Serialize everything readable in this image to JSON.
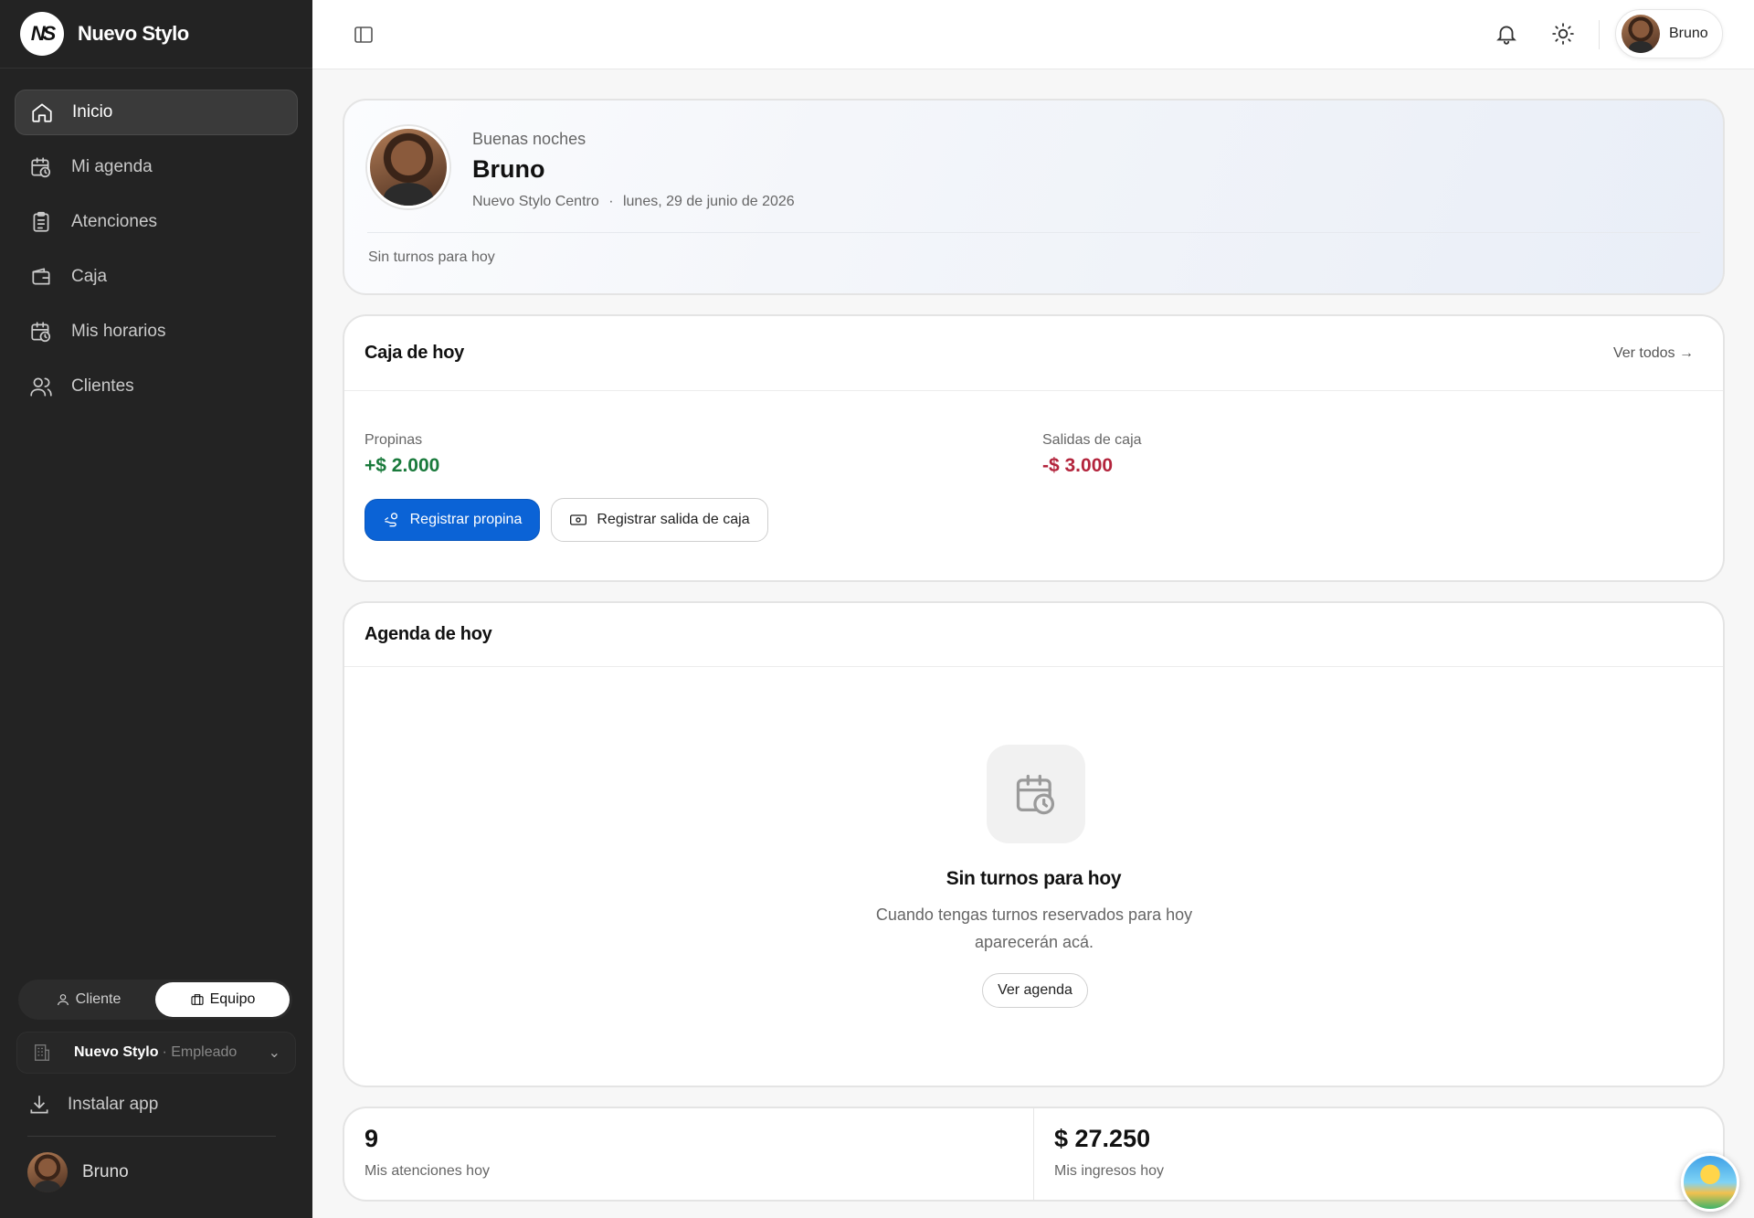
{
  "brand": {
    "name": "Nuevo Stylo",
    "logo_text": "NS"
  },
  "sidebar": {
    "items": [
      {
        "label": "Inicio",
        "icon": "home-icon",
        "active": true
      },
      {
        "label": "Mi agenda",
        "icon": "calendar-clock-icon"
      },
      {
        "label": "Atenciones",
        "icon": "clipboard-icon"
      },
      {
        "label": "Caja",
        "icon": "wallet-icon"
      },
      {
        "label": "Mis horarios",
        "icon": "calendar-clock-icon"
      },
      {
        "label": "Clientes",
        "icon": "users-icon"
      }
    ],
    "toggle": {
      "client_label": "Cliente",
      "team_label": "Equipo",
      "selected": "Equipo"
    },
    "org": {
      "name": "Nuevo Stylo",
      "role": "· Empleado"
    },
    "install_label": "Instalar app",
    "user_name": "Bruno"
  },
  "topbar": {
    "user_name": "Bruno"
  },
  "greeting": {
    "salutation": "Buenas noches",
    "name": "Bruno",
    "location": "Nuevo Stylo Centro",
    "separator": "·",
    "date": "lunes, 29 de junio de 2026",
    "status": "Sin turnos para hoy"
  },
  "caja": {
    "title": "Caja de hoy",
    "view_all": "Ver todos →",
    "tips_label": "Propinas",
    "tips_value": "+$ 2.000",
    "outflows_label": "Salidas de caja",
    "outflows_value": "-$ 3.000",
    "register_tip": "Registrar propina",
    "register_outflow": "Registrar salida de caja",
    "colors": {
      "positive": "#1a7a3c",
      "negative": "#b3243c",
      "primary": "#0b63d6"
    }
  },
  "agenda": {
    "title": "Agenda de hoy",
    "empty_title": "Sin turnos para hoy",
    "empty_desc": "Cuando tengas turnos reservados para hoy aparecerán acá.",
    "view_agenda": "Ver agenda"
  },
  "stats": {
    "attentions_value": "9",
    "attentions_label": "Mis atenciones hoy",
    "income_value": "$ 27.250",
    "income_label": "Mis ingresos hoy"
  }
}
